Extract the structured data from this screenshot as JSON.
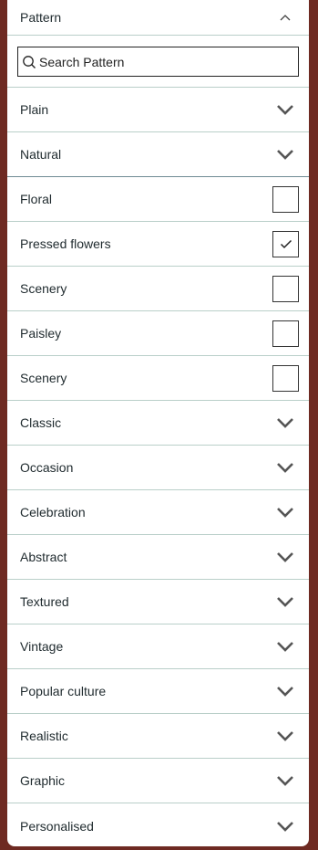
{
  "header": {
    "title": "Pattern",
    "icon": "chevron-up-icon"
  },
  "search": {
    "placeholder": "Search Pattern",
    "icon": "search-icon"
  },
  "collapsed_top": [
    {
      "label": "Plain",
      "icon": "chevron-down-icon"
    },
    {
      "label": "Natural",
      "icon": "chevron-down-icon"
    }
  ],
  "checkbox_items": [
    {
      "label": "Floral",
      "checked": false
    },
    {
      "label": "Pressed flowers",
      "checked": true
    },
    {
      "label": "Scenery",
      "checked": false
    },
    {
      "label": "Paisley",
      "checked": false
    },
    {
      "label": "Scenery",
      "checked": false
    }
  ],
  "categories": [
    {
      "label": "Classic",
      "icon": "chevron-down-icon"
    },
    {
      "label": "Occasion",
      "icon": "chevron-down-icon"
    },
    {
      "label": "Celebration",
      "icon": "chevron-down-icon"
    },
    {
      "label": "Abstract",
      "icon": "chevron-down-icon"
    },
    {
      "label": "Textured",
      "icon": "chevron-down-icon"
    },
    {
      "label": "Vintage",
      "icon": "chevron-down-icon"
    },
    {
      "label": "Popular culture",
      "icon": "chevron-down-icon"
    },
    {
      "label": "Realistic",
      "icon": "chevron-down-icon"
    },
    {
      "label": "Graphic",
      "icon": "chevron-down-icon"
    },
    {
      "label": "Personalised",
      "icon": "chevron-down-icon"
    }
  ],
  "colors": {
    "background": "#6e2a22",
    "divider": "#b9cfc9",
    "text": "#1f2a2e"
  }
}
